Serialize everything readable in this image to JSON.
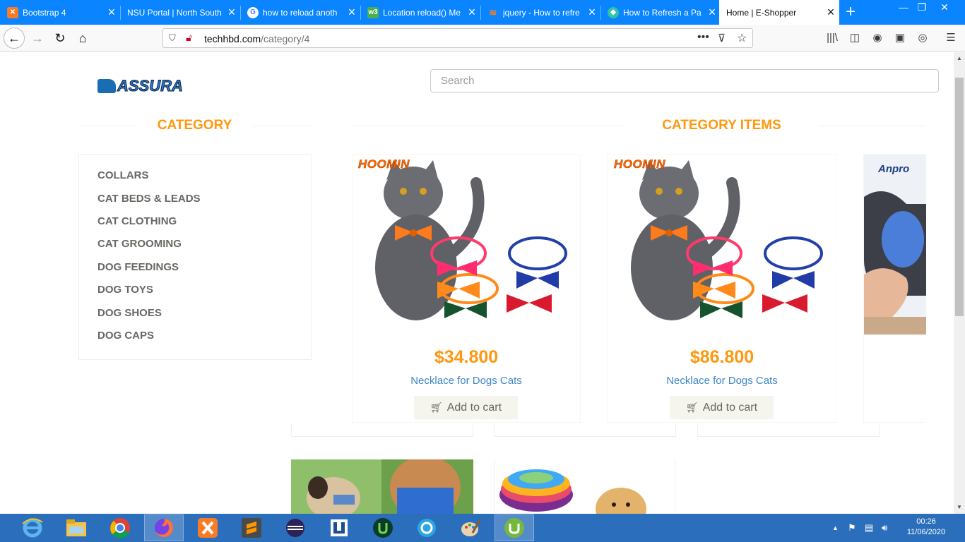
{
  "browser": {
    "tabs": [
      {
        "title": "Bootstrap 4",
        "icon": "xampp-icon"
      },
      {
        "title": "NSU Portal | North South",
        "icon": "none"
      },
      {
        "title": "how to reload anoth",
        "icon": "google-icon"
      },
      {
        "title": "Location reload() Me",
        "icon": "w3schools-icon"
      },
      {
        "title": "jquery - How to refre",
        "icon": "stackoverflow-icon"
      },
      {
        "title": "How to Refresh a Pa",
        "icon": "shield-icon"
      },
      {
        "title": "Home | E-Shopper",
        "icon": "none",
        "active": true
      }
    ],
    "url_host": "techhbd.com",
    "url_path": "/category/4"
  },
  "page": {
    "logo_text": "ASSURA",
    "search_placeholder": "Search",
    "category_title": "CATEGORY",
    "items_title": "CATEGORY ITEMS",
    "categories": [
      "COLLARS",
      "CAT BEDS & LEADS",
      "CAT CLOTHING",
      "CAT GROOMING",
      "DOG FEEDINGS",
      "DOG TOYS",
      "DOG SHOES",
      "DOG CAPS"
    ],
    "products": [
      {
        "brand": "HOOMIN",
        "price": "$34.800",
        "name": "Necklace for Dogs Cats",
        "cart_label": "Add to cart"
      },
      {
        "brand": "HOOMIN",
        "price": "$86.800",
        "name": "Necklace for Dogs Cats",
        "cart_label": "Add to cart"
      },
      {
        "brand": "Anpro"
      }
    ]
  },
  "taskbar": {
    "time": "00:26",
    "date": "11/06/2020"
  },
  "colors": {
    "accent": "#fe980f",
    "link": "#3c87c9",
    "tabbar": "#0a84ff",
    "taskbar": "#2b6fbc"
  }
}
